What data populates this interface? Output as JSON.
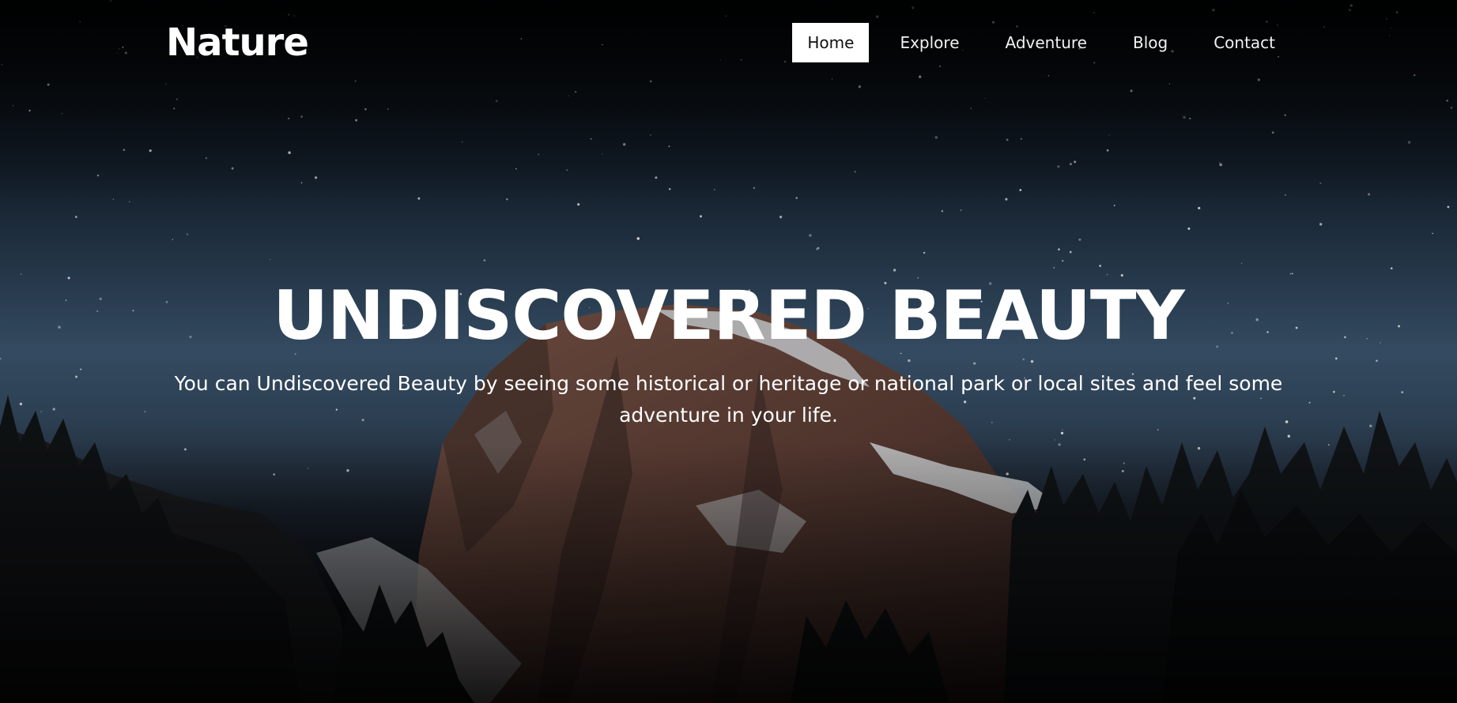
{
  "header": {
    "logo_text": "Nature"
  },
  "nav": {
    "items": [
      {
        "label": "Home",
        "active": true
      },
      {
        "label": "Explore",
        "active": false
      },
      {
        "label": "Adventure",
        "active": false
      },
      {
        "label": "Blog",
        "active": false
      },
      {
        "label": "Contact",
        "active": false
      }
    ]
  },
  "hero": {
    "title": "UNDISCOVERED BEAUTY",
    "subtitle": "You can Undiscovered Beauty by seeing some historical or heritage or national park or local sites and feel some adventure in your life."
  },
  "colors": {
    "text": "#ffffff",
    "active_nav_bg": "#ffffff",
    "active_nav_text": "#111111"
  }
}
